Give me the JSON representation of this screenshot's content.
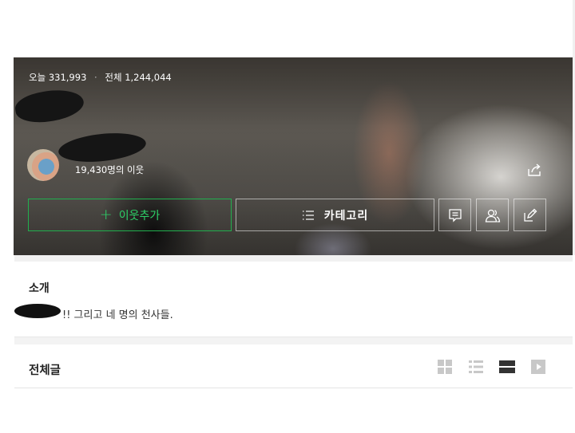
{
  "header": {
    "stats": {
      "today_label": "오늘",
      "today_count": "331,993",
      "separator": "·",
      "total_label": "전체",
      "total_count": "1,244,044"
    },
    "neighbor_count_text": "19,430명의 이웃"
  },
  "actions": {
    "add_neighbor_label": "이웃추가",
    "add_neighbor_plus": "+",
    "category_label": "카테고리"
  },
  "intro": {
    "title": "소개",
    "text": "!! 그리고 네 명의 천사들."
  },
  "posts": {
    "title": "전체글"
  },
  "colors": {
    "accent_green": "#21b04e",
    "accent_green_text": "#2dd268",
    "view_icon_active": "#333333",
    "view_icon_inactive": "#c8c8c8"
  },
  "icons": [
    "share-icon",
    "chat-icon",
    "people-icon",
    "write-icon",
    "list-icon",
    "grid-view-icon",
    "list-view-icon",
    "card-view-icon",
    "video-view-icon"
  ]
}
